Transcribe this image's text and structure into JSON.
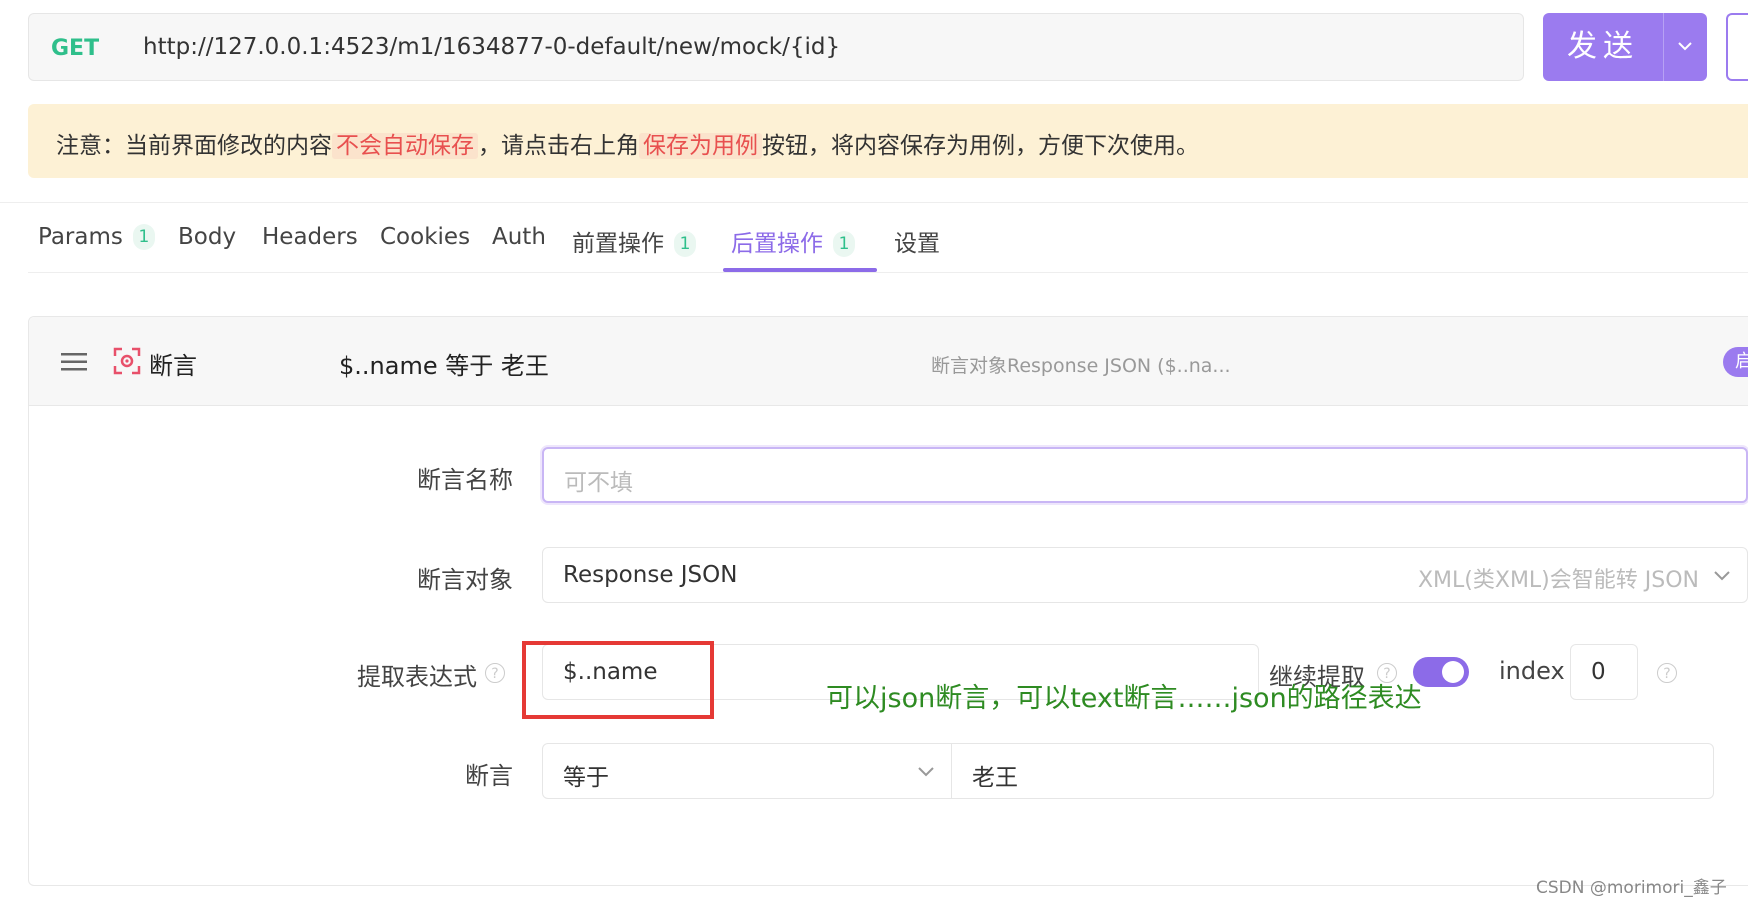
{
  "request": {
    "method": "GET",
    "url": "http://127.0.0.1:4523/m1/1634877-0-default/new/mock/{id}",
    "send_label": "发送"
  },
  "notice": {
    "part1": "注意：当前界面修改的内容",
    "highlight1": "不会自动保存",
    "part2": "，请点击右上角",
    "highlight2": "保存为用例",
    "part3": "按钮，将内容保存为用例，方便下次使用。"
  },
  "tabs": [
    {
      "label": "Params",
      "badge": "1"
    },
    {
      "label": "Body",
      "badge": ""
    },
    {
      "label": "Headers",
      "badge": ""
    },
    {
      "label": "Cookies",
      "badge": ""
    },
    {
      "label": "Auth",
      "badge": ""
    },
    {
      "label": "前置操作",
      "badge": "1"
    },
    {
      "label": "后置操作",
      "badge": "1"
    },
    {
      "label": "设置",
      "badge": ""
    }
  ],
  "assertion": {
    "type": "断言",
    "summary": "$..name 等于 老王",
    "target_summary": "断言对象Response JSON ($..na...",
    "enable_label": "启",
    "fields": {
      "name_label": "断言名称",
      "name_placeholder": "可不填",
      "target_label": "断言对象",
      "target_value": "Response JSON",
      "target_hint": "XML(类XML)会智能转 JSON",
      "expr_label": "提取表达式",
      "expr_value": "$..name",
      "continue_label": "继续提取",
      "index_label": "index",
      "index_value": "0",
      "assert_label": "断言",
      "operator": "等于",
      "expected_value": "老王"
    }
  },
  "annotation": "可以json断言，可以text断言……json的路径表达",
  "watermark": "CSDN @morimori_鑫子",
  "colors": {
    "accent": "#8c6be8",
    "method_get": "#2fbf8b",
    "notice_bg": "#fdf1d5",
    "highlight": "#e8504f",
    "annotation": "#2e8b22",
    "red_box": "#e53935"
  }
}
